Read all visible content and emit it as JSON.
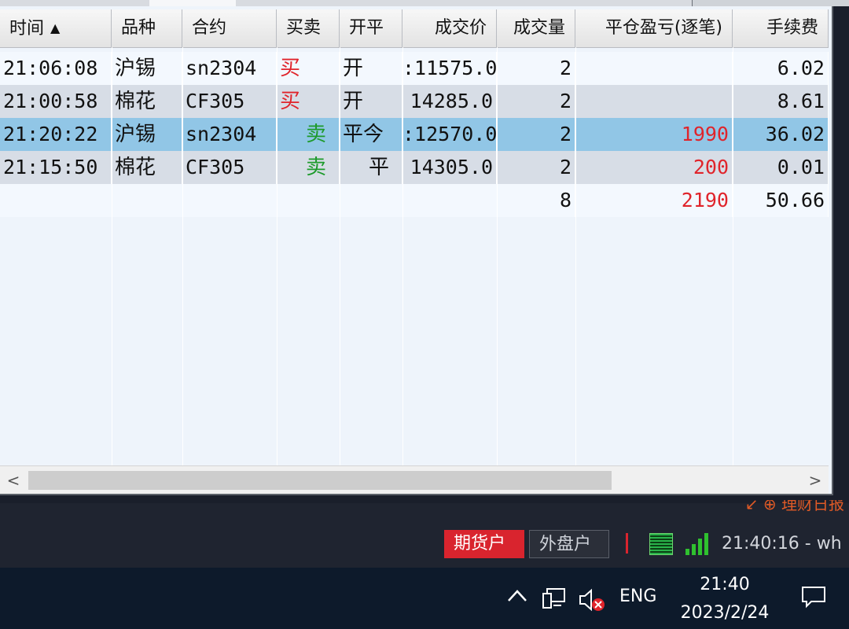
{
  "grid": {
    "columns": [
      {
        "label": "时间",
        "sort": "▲"
      },
      {
        "label": "品种"
      },
      {
        "label": "合约"
      },
      {
        "label": "买卖"
      },
      {
        "label": "开平"
      },
      {
        "label": "成交价"
      },
      {
        "label": "成交量"
      },
      {
        "label": "平仓盈亏(逐笔)"
      },
      {
        "label": "手续费"
      }
    ],
    "rows": [
      {
        "time": "21:06:08",
        "product": "沪锡",
        "contract": "sn2304",
        "side": "买",
        "side_color": "#e0242b",
        "open_close": "开",
        "price": ":11575.0",
        "qty": "2",
        "pnl": "",
        "fee": "6.02"
      },
      {
        "time": "21:00:58",
        "product": "棉花",
        "contract": "CF305",
        "side": "买",
        "side_color": "#e0242b",
        "open_close": "开",
        "price": "14285.0",
        "qty": "2",
        "pnl": "",
        "fee": "8.61"
      },
      {
        "time": "21:20:22",
        "product": "沪锡",
        "contract": "sn2304",
        "side": "卖",
        "side_color": "#1d9a2b",
        "open_close": "平今",
        "price": ":12570.0",
        "qty": "2",
        "pnl": "1990",
        "fee": "36.02"
      },
      {
        "time": "21:15:50",
        "product": "棉花",
        "contract": "CF305",
        "side": "卖",
        "side_color": "#1d9a2b",
        "open_close": "平",
        "price": "14305.0",
        "qty": "2",
        "pnl": "200",
        "fee": "0.01"
      }
    ],
    "totals": {
      "qty": "8",
      "pnl": "2190",
      "fee": "50.66"
    }
  },
  "scrollbar": {
    "left_arrow": "<",
    "right_arrow": ">"
  },
  "statusbar": {
    "top_text": "↙ ⊕ 理财日报",
    "account_futures": "期货户",
    "account_foreign": "外盘户",
    "time": "21:40:16 - wh"
  },
  "taskbar": {
    "chevron": "^",
    "language": "ENG",
    "clock_time": "21:40",
    "clock_date": "2023/2/24"
  },
  "colors": {
    "buy": "#e0242b",
    "sell": "#1d9a2b",
    "selected_row": "#91c6e6",
    "pnl_positive": "#e0242b"
  }
}
